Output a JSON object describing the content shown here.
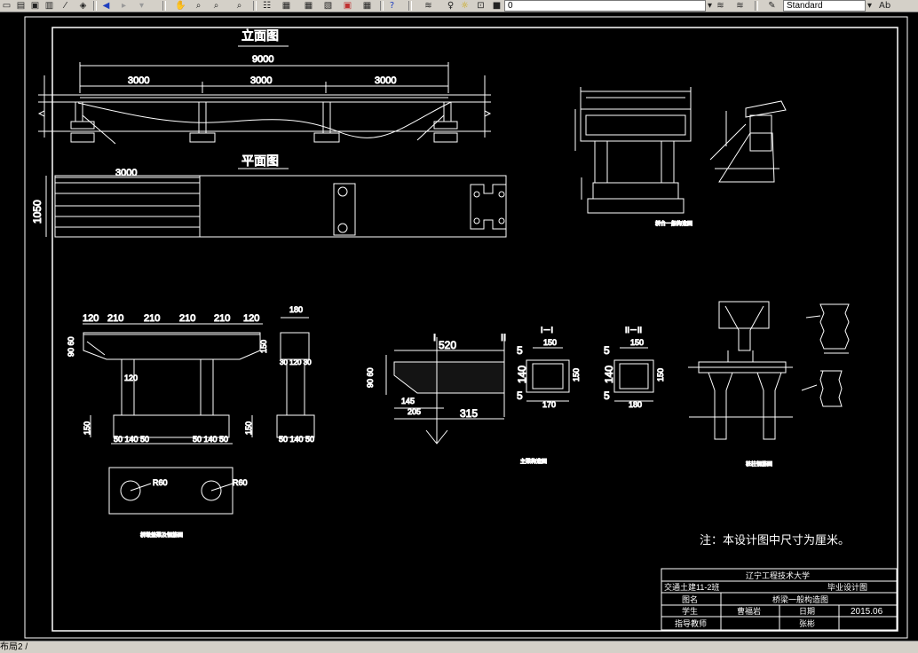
{
  "toolbar": {
    "layer_value": "0",
    "style_value": "Standard",
    "edge_label": "Ab"
  },
  "status": {
    "layout_tab": "布局2 /"
  },
  "drawing": {
    "elevation_title": "立面图",
    "total_length": "9000",
    "span_1": "3000",
    "span_2": "3000",
    "span_3": "3000",
    "plan_title": "平面图",
    "plan_span": "3000",
    "plan_width": "1050",
    "abutment_caption": "桥台一般构造图",
    "pier_caption": "桥墩盖梁及钢筋图",
    "deck_caption": "主梁构造图",
    "pile_caption": "桩柱钢筋图",
    "note": "注：本设计图中尺寸为厘米。",
    "pier_dims": [
      "120",
      "210",
      "210",
      "210",
      "210",
      "120"
    ],
    "pier_width_180": "180",
    "pier_120": "120",
    "pier_side_dims": "30 120 30",
    "pier_left_dims": "90 60",
    "pier_right_h": "150",
    "pier_left_base": "150",
    "pier_base_a": "50 140 50",
    "pier_base_b": "50 140 50",
    "pier_base_c": "50 140 50",
    "pier_side_h": "150",
    "radius_a": "R60",
    "radius_b": "R60",
    "beam_label_i": "I",
    "beam_label_ii": "II",
    "beam_520": "520",
    "beam_side": "90 60",
    "beam_145": "145",
    "beam_205": "205",
    "beam_315": "315",
    "sec1_title": "I－I",
    "sec1_150": "150",
    "sec1_140": "140",
    "sec1_h": "150",
    "sec1_170": "170",
    "sec1_5a": "5",
    "sec1_5b": "5",
    "sec2_title": "II－II",
    "sec2_150": "150",
    "sec2_140": "140",
    "sec2_h": "150",
    "sec2_180": "180",
    "sec2_5a": "5",
    "sec2_5b": "5"
  },
  "title_block": {
    "school": "辽宁工程技术大学",
    "class_name": "交通土建11-2班",
    "drawing_type": "毕业设计图",
    "name_label": "图名",
    "name_value": "桥梁一般构造图",
    "student_label": "学生",
    "student_value": "曹福岩",
    "date_label": "日期",
    "date_value": "2015.06",
    "advisor_label": "指导教师",
    "advisor_value": "张彬"
  }
}
